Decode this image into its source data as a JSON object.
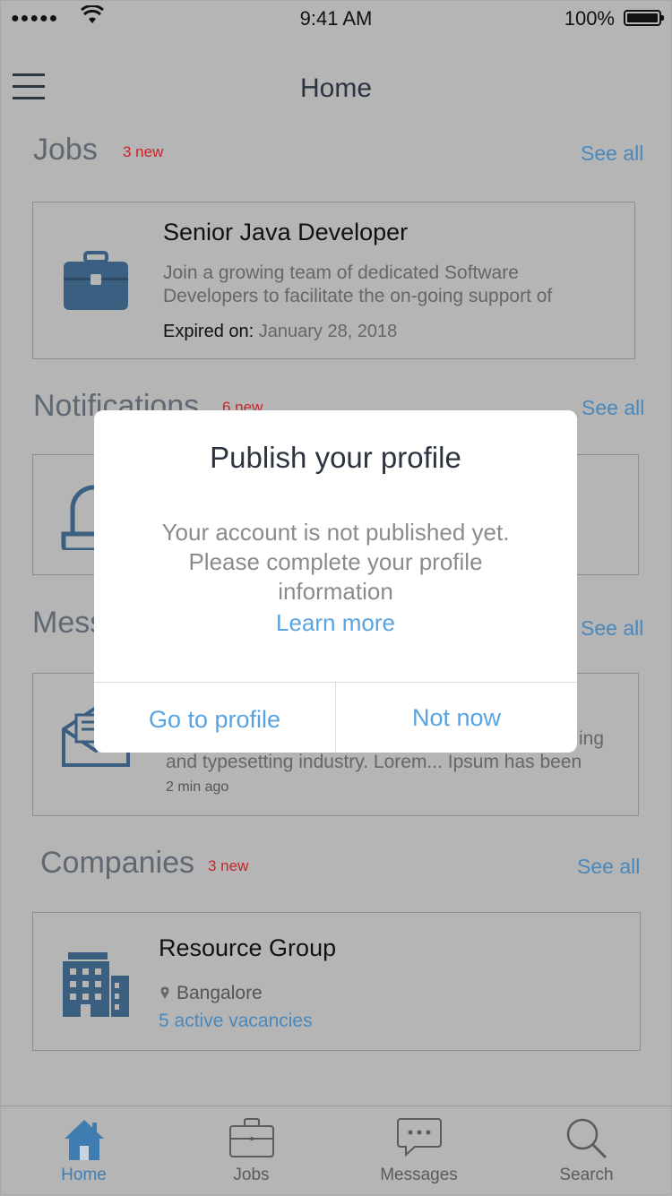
{
  "status_bar": {
    "signal": "●●●●●",
    "time": "9:41 AM",
    "battery_pct": "100%"
  },
  "nav": {
    "title": "Home"
  },
  "jobs": {
    "title": "Jobs",
    "badge": "3 new",
    "see_all": "See all",
    "card": {
      "title": "Senior Java Developer",
      "desc_line1": "Join a growing team of dedicated Software",
      "desc_line2": "Developers to facilitate the on-going support of",
      "expired_label": "Expired on:",
      "expired_value": "January 28, 2018"
    }
  },
  "notifications": {
    "title": "Notifications",
    "badge": "6 new",
    "see_all": "See all"
  },
  "messages": {
    "title": "Mess",
    "see_all": "See all",
    "card": {
      "line_tail": "ing",
      "line2": "and typesetting industry. Lorem... Ipsum has been",
      "time": "2 min ago"
    }
  },
  "companies": {
    "title": "Companies",
    "badge": "3 new",
    "see_all": "See all",
    "card": {
      "title": "Resource Group",
      "location": "Bangalore",
      "vacancies": "5 active vacancies"
    }
  },
  "modal": {
    "title": "Publish your profile",
    "body_line1": "Your account is not published yet.",
    "body_line2": "Please complete your profile",
    "body_line3": "information",
    "learn_more": "Learn more",
    "primary": "Go to profile",
    "secondary": "Not now"
  },
  "tabbar": {
    "items": [
      {
        "label": "Home",
        "icon": "home-icon",
        "active": true
      },
      {
        "label": "Jobs",
        "icon": "briefcase-icon",
        "active": false
      },
      {
        "label": "Messages",
        "icon": "chat-bubble-icon",
        "active": false
      },
      {
        "label": "Search",
        "icon": "search-icon",
        "active": false
      }
    ]
  },
  "colors": {
    "accent": "#5aa3e0",
    "badge": "#c8252a",
    "icon": "#3b5f80",
    "overlay": "#b5b5b5"
  }
}
